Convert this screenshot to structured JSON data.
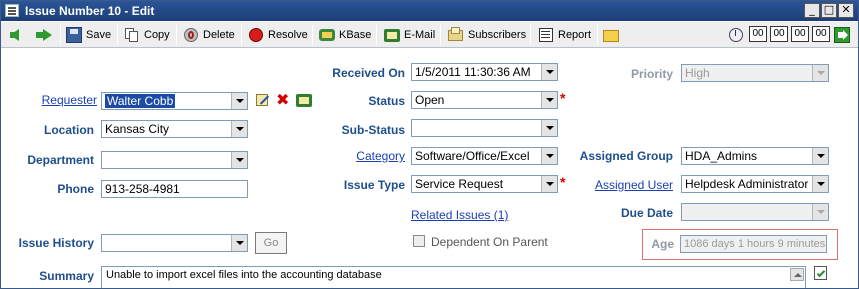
{
  "window": {
    "title": "Issue Number 10 - Edit",
    "minimize": "_",
    "maximize": "□",
    "close": "✕"
  },
  "toolbar": {
    "save": "Save",
    "copy": "Copy",
    "delete": "Delete",
    "resolve": "Resolve",
    "kbase": "KBase",
    "email": "E-Mail",
    "subscribers": "Subscribers",
    "report": "Report",
    "timer": [
      "00",
      "00",
      "00",
      "00"
    ]
  },
  "form": {
    "requester": {
      "label": "Requester",
      "value": "Walter Cobb"
    },
    "location": {
      "label": "Location",
      "value": "Kansas City"
    },
    "department": {
      "label": "Department",
      "value": ""
    },
    "phone": {
      "label": "Phone",
      "value": "913-258-4981"
    },
    "issue_history": {
      "label": "Issue History",
      "value": "",
      "go": "Go"
    },
    "received_on": {
      "label": "Received On",
      "value": "1/5/2011 11:30:36 AM"
    },
    "status": {
      "label": "Status",
      "value": "Open"
    },
    "sub_status": {
      "label": "Sub-Status",
      "value": ""
    },
    "category": {
      "label": "Category",
      "value": "Software/Office/Excel"
    },
    "issue_type": {
      "label": "Issue Type",
      "value": "Service Request"
    },
    "related_issues": "Related Issues (1)",
    "dependent_on_parent": "Dependent On Parent",
    "priority": {
      "label": "Priority",
      "value": "High"
    },
    "assigned_group": {
      "label": "Assigned Group",
      "value": "HDA_Admins"
    },
    "assigned_user": {
      "label": "Assigned User",
      "value": "Helpdesk Administrator"
    },
    "due_date": {
      "label": "Due Date",
      "value": ""
    },
    "age": {
      "label": "Age",
      "value": "1086 days 1 hours 9 minutes"
    },
    "summary": {
      "label": "Summary",
      "value": "Unable to import excel files into the accounting database"
    }
  },
  "colors": {
    "title_bar": "#2a5597",
    "label_text": "#1f4e8c",
    "link_text": "#1a3fb4",
    "required_mark": "#dd0000",
    "age_highlight": "#e07070"
  }
}
